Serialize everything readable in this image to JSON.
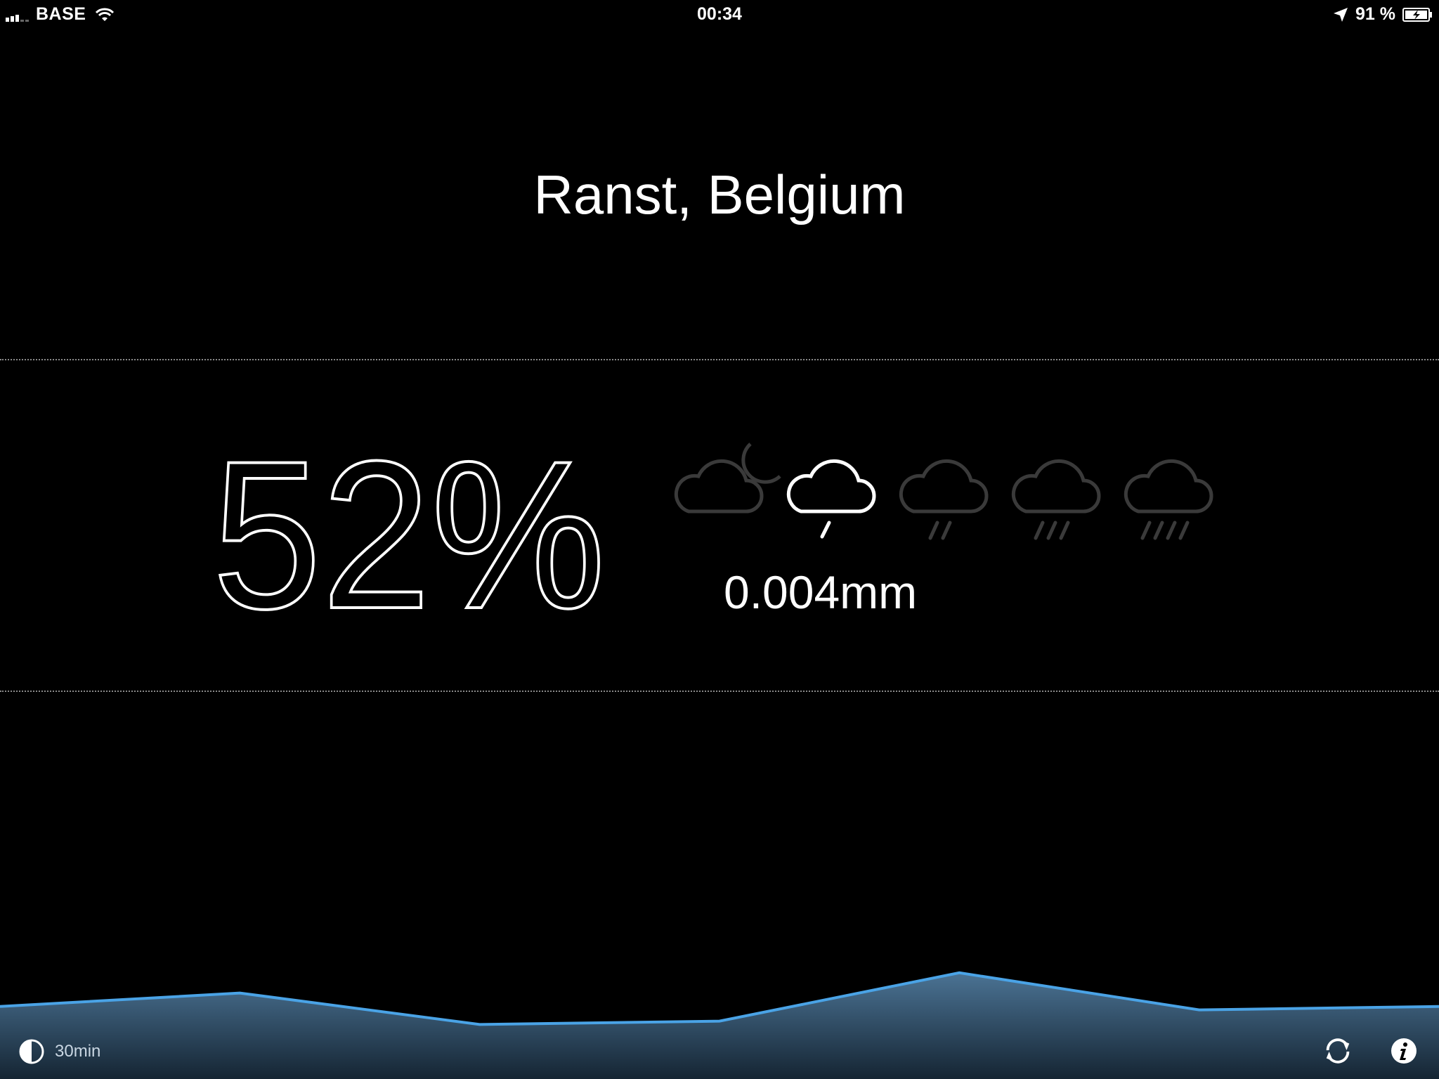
{
  "status_bar": {
    "carrier": "BASE",
    "time": "00:34",
    "battery": "91 %",
    "icons": [
      "signal-icon",
      "wifi-icon",
      "location-arrow-icon",
      "battery-charging-icon"
    ]
  },
  "location": "Ranst, Belgium",
  "precipitation": {
    "chance": "52%",
    "amount": "0.004mm",
    "intensity_icons": [
      {
        "name": "partly-cloudy-night-icon",
        "active": false
      },
      {
        "name": "light-rain-icon",
        "active": true
      },
      {
        "name": "moderate-rain-icon",
        "active": false
      },
      {
        "name": "heavy-rain-icon",
        "active": false
      },
      {
        "name": "very-heavy-rain-icon",
        "active": false
      }
    ]
  },
  "chart_data": {
    "type": "area",
    "title": "",
    "xlabel": "",
    "ylabel": "",
    "values": [
      52,
      64,
      36,
      39,
      82,
      49,
      52
    ],
    "grid": false,
    "colors": {
      "line": "#4aa3e6",
      "fill_top": "#4b7394",
      "fill_bottom": "#152533"
    }
  },
  "toolbar": {
    "interval_label": "30min",
    "icons": [
      "half-circle-icon",
      "refresh-icon",
      "info-icon"
    ]
  },
  "colors": {
    "background": "#000000",
    "text": "#ffffff",
    "inactive_icon": "#3a3a3a",
    "divider": "#8a8a8a"
  }
}
